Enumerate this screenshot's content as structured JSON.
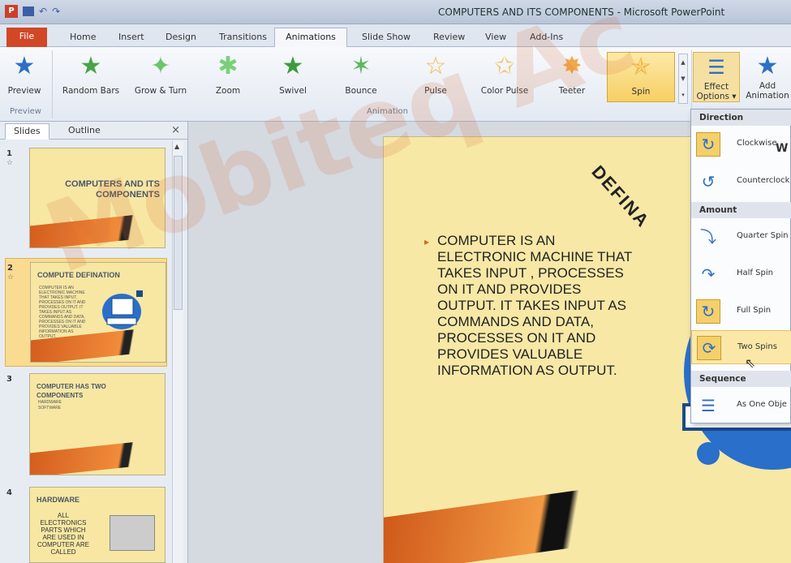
{
  "window": {
    "title": "COMPUTERS AND ITS COMPONENTS - Microsoft PowerPoint",
    "app_icon": "P"
  },
  "ribbon_tabs": [
    "File",
    "Home",
    "Insert",
    "Design",
    "Transitions",
    "Animations",
    "Slide Show",
    "Review",
    "View",
    "Add-Ins"
  ],
  "active_tab": "Animations",
  "ribbon": {
    "preview_label": "Preview",
    "preview_group": "Preview",
    "animation_group": "Animation",
    "effects": [
      {
        "label": "Random Bars",
        "icon": "star-icon"
      },
      {
        "label": "Grow & Turn",
        "icon": "star-icon"
      },
      {
        "label": "Zoom",
        "icon": "star-icon"
      },
      {
        "label": "Swivel",
        "icon": "star-icon"
      },
      {
        "label": "Bounce",
        "icon": "star-icon"
      },
      {
        "label": "Pulse",
        "icon": "star-icon"
      },
      {
        "label": "Color Pulse",
        "icon": "star-icon"
      },
      {
        "label": "Teeter",
        "icon": "star-icon"
      },
      {
        "label": "Spin",
        "icon": "star-icon"
      }
    ],
    "effect_options_label_1": "Effect",
    "effect_options_label_2": "Options",
    "add_animation_label_1": "Add",
    "add_animation_label_2": "Animation"
  },
  "slides_pane": {
    "tab_slides": "Slides",
    "tab_outline": "Outline",
    "close": "×",
    "slides": [
      {
        "num": "1",
        "title": "COMPUTERS AND ITS COMPONENTS"
      },
      {
        "num": "2",
        "title": "COMPUTE DEFINATION",
        "body": "COMPUTER IS AN ELECTRONIC MACHINE THAT TAKES INPUT, PROCESSES ON IT AND PROVIDES OUTPUT. IT TAKES INPUT AS COMMANDS AND DATA, PROCESSES ON IT AND PROVIDES VALUABLE INFORMATION AS OUTPUT."
      },
      {
        "num": "3",
        "title": "COMPUTER HAS TWO COMPONENTS",
        "items": [
          "HARDWARE",
          "SOFTWARE"
        ]
      },
      {
        "num": "4",
        "title": "HARDWARE",
        "body": "ALL ELECTRONICS PARTS WHICH ARE USED IN COMPUTER ARE CALLED"
      }
    ]
  },
  "main_slide": {
    "title_fragment": "DEFINA",
    "body": "COMPUTER IS AN ELECTRONIC MACHINE THAT TAKES INPUT , PROCESSES ON IT AND PROVIDES OUTPUT. IT TAKES INPUT AS COMMANDS AND DATA, PROCESSES ON IT AND PROVIDES VALUABLE INFORMATION AS OUTPUT."
  },
  "watermark": "Mobiteq Ac",
  "effect_menu": {
    "direction_header": "Direction",
    "amount_header": "Amount",
    "sequence_header": "Sequence",
    "items": {
      "clockwise": "Clockwise",
      "counterclockwise": "Counterclock",
      "quarter": "Quarter Spin",
      "half": "Half Spin",
      "full": "Full Spin",
      "two": "Two Spins",
      "as_one": "As One Obje"
    },
    "overlay_letters": "W"
  },
  "colors": {
    "accent_file": "#d24726",
    "highlight": "#fbe8a8",
    "slide_bg": "#f7e8a6"
  }
}
